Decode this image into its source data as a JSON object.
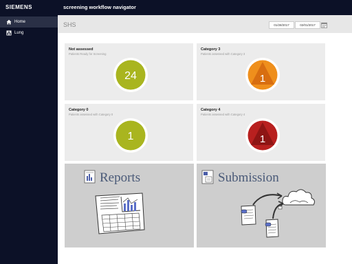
{
  "header": {
    "brand": "SIEMENS",
    "app_title": "screening workflow navigator"
  },
  "sidebar": {
    "items": [
      {
        "label": "Home",
        "icon": "home-icon",
        "active": true
      },
      {
        "label": "Lung",
        "icon": "lung-icon",
        "active": false
      }
    ]
  },
  "toolbar": {
    "title": "SHS",
    "date_from": "01/28/2017",
    "date_to": "02/01/2017"
  },
  "cards": [
    {
      "title": "Not assessed",
      "subtitle": "Patients Ready for Screening",
      "count": "24",
      "color": "#a9b51f",
      "shape": "circle"
    },
    {
      "title": "Category 3",
      "subtitle": "Patients assessed with Category 3",
      "count": "1",
      "color": "#ef8f1c",
      "shape": "triangle"
    },
    {
      "title": "Category 0",
      "subtitle": "Patients assessed with Category 0",
      "count": "1",
      "color": "#a9b51f",
      "shape": "circle"
    },
    {
      "title": "Category 4",
      "subtitle": "Patients assessed with Category 4",
      "count": "1",
      "color": "#b8201f",
      "shape": "triangle"
    }
  ],
  "tiles": {
    "reports": "Reports",
    "submission": "Submission"
  }
}
